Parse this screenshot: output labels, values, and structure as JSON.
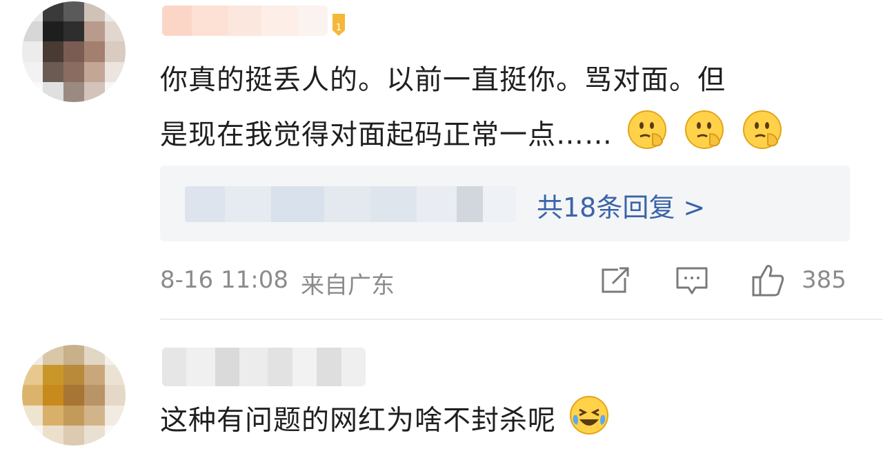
{
  "comments": [
    {
      "text_line1": "你真的挺丢人的。以前一直挺你。骂对面。但",
      "text_line2": "是现在我觉得对面起码正常一点……",
      "emojis": [
        "thinking-face-icon",
        "thinking-face-icon",
        "thinking-face-icon"
      ],
      "badge": "1",
      "reply_count_label": "共18条回复 >",
      "timestamp": "8-16 11:08",
      "location": "来自广东",
      "like_count": "385"
    },
    {
      "text": "这种有问题的网红为啥不封杀呢",
      "emojis": [
        "laughing-crying-face-icon"
      ]
    }
  ],
  "colors": {
    "reply_link": "#3a64a8",
    "meta_text": "#8b8b8b",
    "reply_bg": "#f4f5f7",
    "emoji_yellow": "#ffd24a"
  }
}
